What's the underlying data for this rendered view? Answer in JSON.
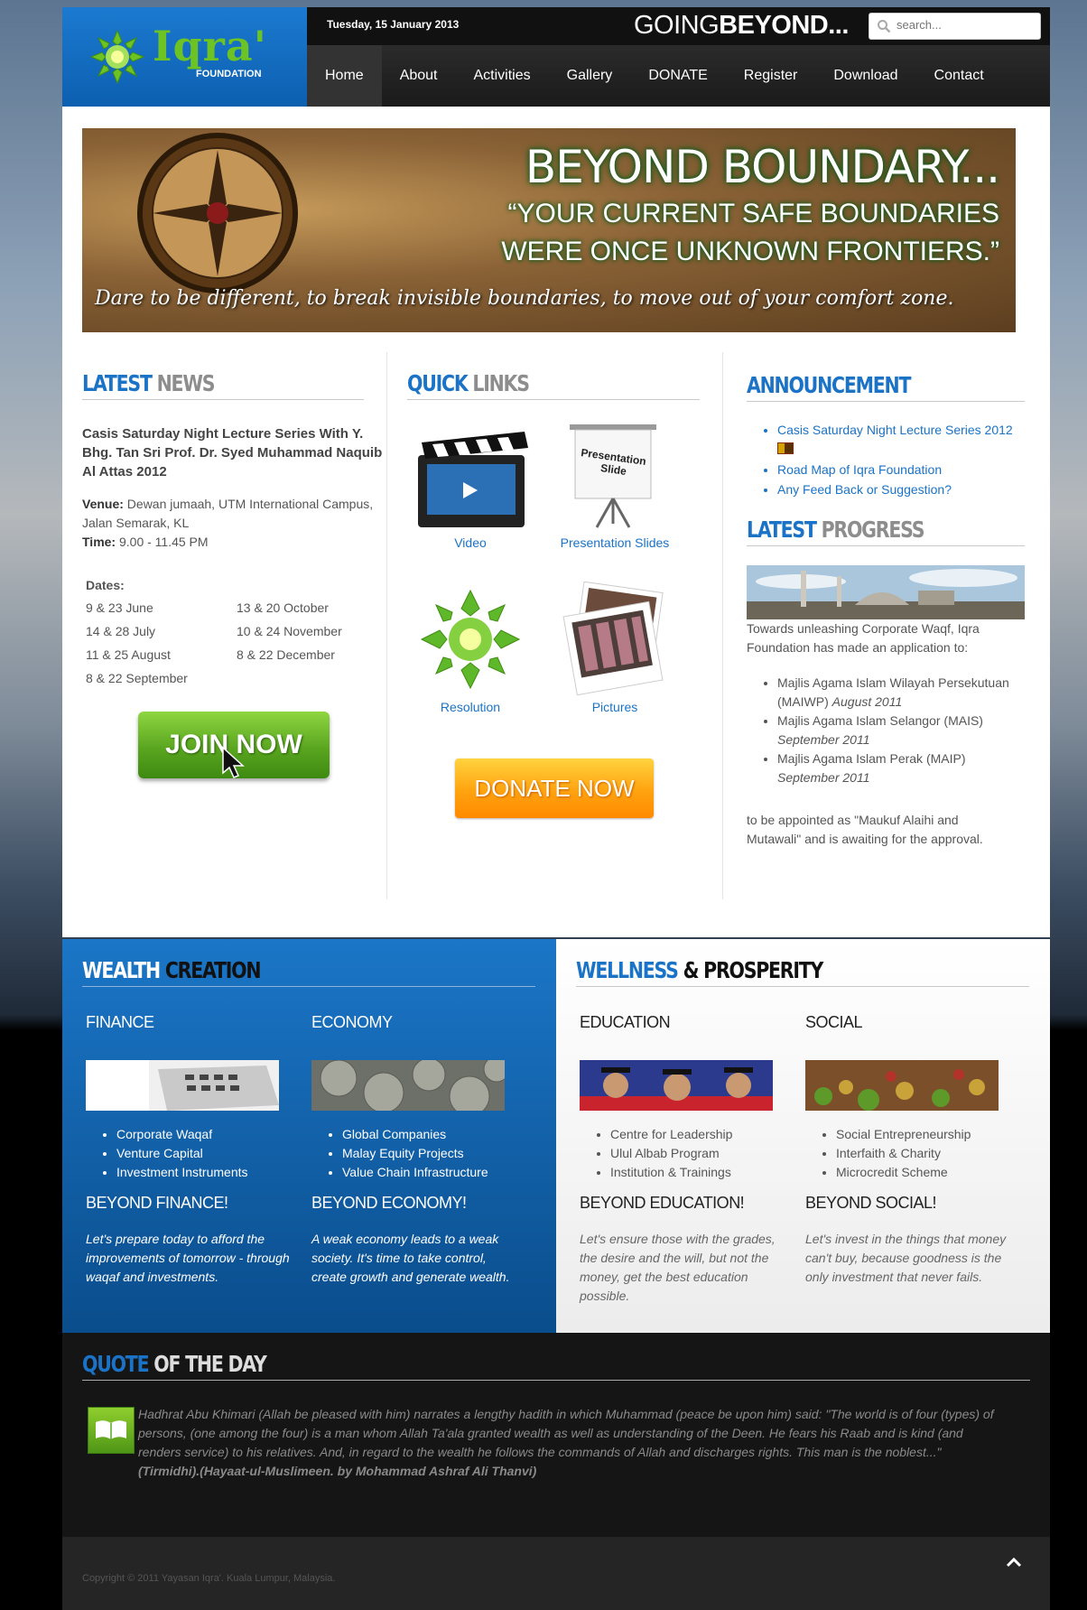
{
  "header": {
    "logo_text": "Iqra'",
    "logo_sub": "FOUNDATION",
    "date": "Tuesday, 15 January 2013",
    "tagline_light": "GOING",
    "tagline_bold": "BEYOND...",
    "search_placeholder": "search..."
  },
  "nav": [
    "Home",
    "About",
    "Activities",
    "Gallery",
    "DONATE",
    "Register",
    "Download",
    "Contact"
  ],
  "banner": {
    "headline": "BEYOND BOUNDARY...",
    "quote_line1": "“YOUR CURRENT SAFE BOUNDARIES",
    "quote_line2": "WERE ONCE UNKNOWN FRONTIERS.”",
    "script": "Dare to be different, to break invisible boundaries, to move out of your comfort zone."
  },
  "latest_news": {
    "title_a": "LATEST",
    "title_b": "NEWS",
    "headline": "Casis Saturday Night Lecture Series With Y. Bhg. Tan Sri Prof. Dr. Syed Muhammad Naquib Al Attas 2012",
    "venue_label": "Venue:",
    "venue": "Dewan jumaah, UTM International Campus, Jalan Semarak, KL",
    "time_label": "Time:",
    "time": "9.00 - 11.45 PM",
    "dates_label": "Dates:",
    "dates": [
      "9 & 23 June",
      "13 & 20 October",
      "14 & 28 July",
      "10 & 24 November",
      "11 & 25 August",
      "8 & 22 December",
      "8 & 22 September",
      ""
    ],
    "join_label": "JOIN NOW"
  },
  "quick_links": {
    "title_a": "QUICK",
    "title_b": "LINKS",
    "items": [
      "Video",
      "Presentation Slides",
      "Resolution",
      "Pictures"
    ],
    "slide_text": "Presentation Slide",
    "donate_label": "DONATE NOW"
  },
  "announcement": {
    "title_a": "ANNOUNCEMENT",
    "items": [
      "Casis Saturday Night Lecture Series 2012",
      "Road Map of Iqra Foundation",
      "Any Feed Back or Suggestion?"
    ]
  },
  "progress": {
    "title_a": "LATEST",
    "title_b": "PROGRESS",
    "intro": "Towards unleashing Corporate Waqf, Iqra Foundation has made an application to:",
    "items": [
      {
        "name": "Majlis Agama Islam Wilayah Persekutuan (MAIWP)",
        "date": "August 2011"
      },
      {
        "name": "Majlis Agama Islam Selangor (MAIS)",
        "date": "September 2011"
      },
      {
        "name": "Majlis Agama Islam Perak (MAIP)",
        "date": "September 2011"
      }
    ],
    "ending": "to be appointed as \"Maukuf Alaihi and Mutawali\" and is awaiting for the approval."
  },
  "wealth": {
    "title_a": "WEALTH",
    "title_b": "CREATION",
    "finance": {
      "title": "FINANCE",
      "items": [
        "Corporate Waqaf",
        "Venture Capital",
        "Investment Instruments"
      ],
      "beyond": "BEYOND FINANCE!",
      "text": "Let's prepare today to afford the improvements of tomorrow - through waqaf and investments."
    },
    "economy": {
      "title": "ECONOMY",
      "items": [
        "Global Companies",
        "Malay Equity Projects",
        "Value Chain Infrastructure"
      ],
      "beyond": "BEYOND ECONOMY!",
      "text": "A weak economy leads to a weak society. It's time to take control, create growth and generate wealth."
    }
  },
  "wellness": {
    "title_a": "WELLNESS",
    "title_b": "& PROSPERITY",
    "education": {
      "title": "EDUCATION",
      "items": [
        "Centre for Leadership",
        "Ulul Albab Program",
        "Institution & Trainings"
      ],
      "beyond": "BEYOND EDUCATION!",
      "text": "Let's ensure those with the grades, the desire and the will, but not the money, get the best education possible."
    },
    "social": {
      "title": "SOCIAL",
      "items": [
        "Social Entrepreneurship",
        "Interfaith & Charity",
        "Microcredit Scheme"
      ],
      "beyond": "BEYOND SOCIAL!",
      "text": "Let's invest in the things that money can't buy, because goodness is the only investment that never fails."
    }
  },
  "quote": {
    "title_a": "QUOTE",
    "title_b": "OF THE DAY",
    "text": "Hadhrat Abu Khimari (Allah be pleased with him) narrates a lengthy hadith in which Muhammad (peace be upon him) said: \"The world is of four (types) of persons, (one among the four) is a man whom Allah Ta'ala granted wealth as well as understanding of the Deen. He fears his Raab and is kind (and renders service) to his relatives. And, in regard to the wealth he follows the commands of Allah and discharges rights. This man is the noblest...\"",
    "source": "(Tirmidhi).(Hayaat-ul-Muslimeen. by Mohammad Ashraf Ali Thanvi)"
  },
  "footer": {
    "copyright": "Copyright © 2011 Yayasan Iqra'. Kuala Lumpur, Malaysia."
  },
  "colors": {
    "brand_blue": "#1a73c6",
    "brand_green": "#6cc323",
    "donate_orange": "#ffa30f"
  }
}
